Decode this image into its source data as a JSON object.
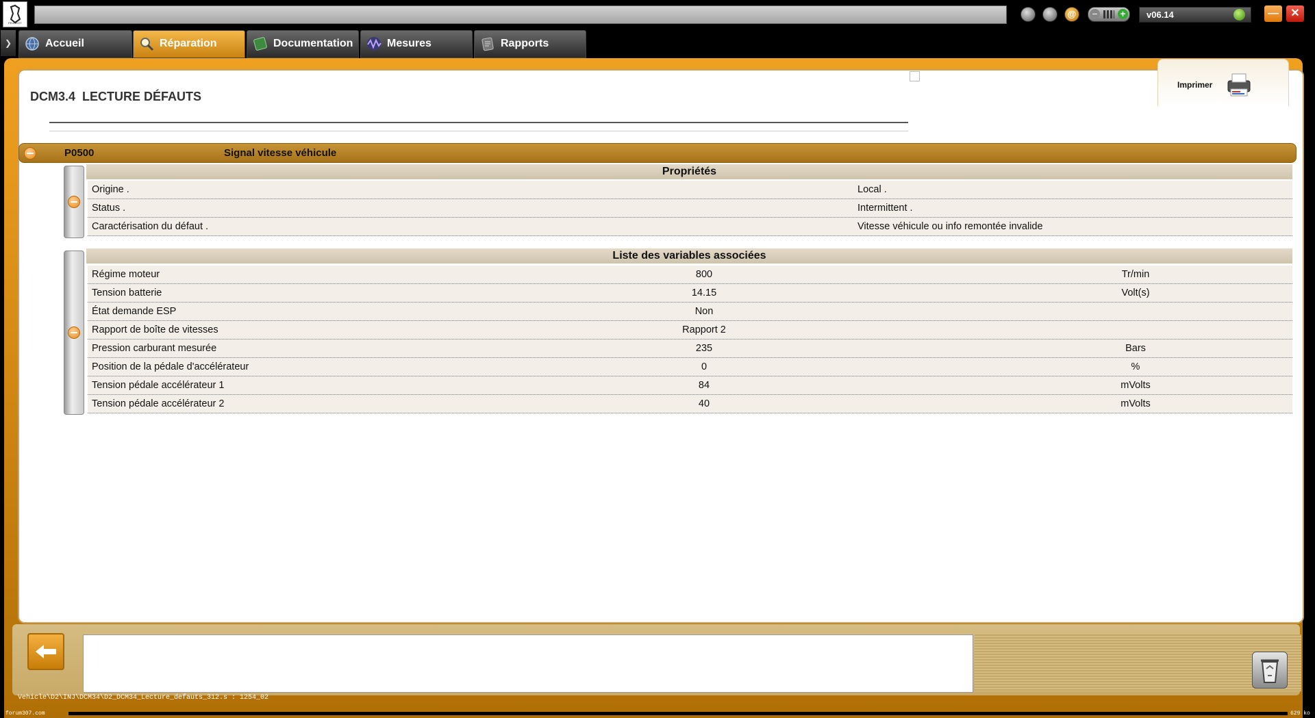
{
  "topbar": {
    "address": "",
    "version": "v06.14",
    "icons": [
      "download-icon",
      "user-icon",
      "email-icon",
      "volume-control",
      "status-led-icon"
    ]
  },
  "tabs": [
    {
      "label": "Accueil",
      "icon": "home-globe-icon",
      "active": false
    },
    {
      "label": "Réparation",
      "icon": "magnifier-icon",
      "active": true
    },
    {
      "label": "Documentation",
      "icon": "book-icon",
      "active": false
    },
    {
      "label": "Mesures",
      "icon": "waveform-icon",
      "active": false
    },
    {
      "label": "Rapports",
      "icon": "report-icon",
      "active": false
    }
  ],
  "panel": {
    "title": "DCM3.4  LECTURE DÉFAUTS",
    "print_label": "Imprimer"
  },
  "fault": {
    "code": "P0500",
    "description": "Signal vitesse véhicule",
    "properties_title": "Propriétés",
    "properties": [
      {
        "name": "Origine .",
        "value": "Local ."
      },
      {
        "name": "Status .",
        "value": "Intermittent ."
      },
      {
        "name": "Caractérisation du défaut .",
        "value": "Vitesse véhicule ou info remontée invalide"
      }
    ],
    "variables_title": "Liste des variables associées",
    "variables": [
      {
        "name": "Régime moteur",
        "value": "800",
        "unit": "Tr/min"
      },
      {
        "name": "Tension batterie",
        "value": "14.15",
        "unit": "Volt(s)"
      },
      {
        "name": "État demande ESP",
        "value": "Non",
        "unit": ""
      },
      {
        "name": "Rapport de boîte de vitesses",
        "value": "Rapport 2",
        "unit": ""
      },
      {
        "name": "Pression carburant mesurée",
        "value": "235",
        "unit": "Bars"
      },
      {
        "name": "Position de la pédale d'accélérateur",
        "value": "0",
        "unit": "%"
      },
      {
        "name": "Tension pédale accélérateur 1",
        "value": "84",
        "unit": "mVolts"
      },
      {
        "name": "Tension pédale accélérateur 2",
        "value": "40",
        "unit": "mVolts"
      }
    ]
  },
  "bottom": {
    "message": "",
    "status_path": "Vehicle\\D2\\INJ\\DCM34\\D2_DCM34_Lecture_defauts_312.s : 1254_02",
    "footer_left": "forum307.com",
    "footer_right": "629 ko"
  },
  "colors": {
    "accent": "#e8a020",
    "frame": "#c98311",
    "fault_bar": "#b07d22",
    "section_head": "#ddd2bf",
    "row_bg": "#f3efe8"
  }
}
